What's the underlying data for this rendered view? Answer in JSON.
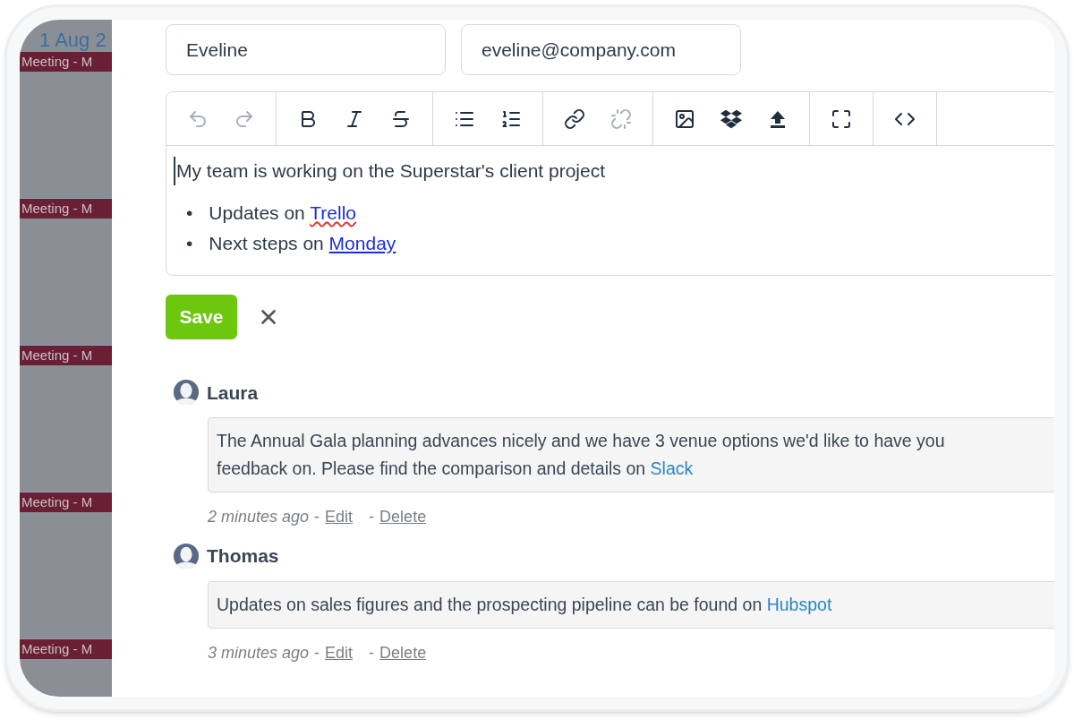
{
  "calendar": {
    "date": "1 Aug 2",
    "events": [
      {
        "label": "Meeting - M",
        "color": "#6b1f35"
      },
      {
        "label": "Meeting - M",
        "color": "#6b1f35"
      },
      {
        "label": "Meeting - M",
        "color": "#6b1f35"
      },
      {
        "label": "Meeting - M",
        "color": "#6b1f35"
      },
      {
        "label": "Meeting - M",
        "color": "#6b1f35"
      }
    ]
  },
  "form": {
    "name": {
      "value": "Eveline"
    },
    "email": {
      "value": "eveline@company.com"
    }
  },
  "toolbar": [
    {
      "group": [
        {
          "kind": "undo",
          "disabled": true
        },
        {
          "kind": "redo",
          "disabled": true
        }
      ]
    },
    {
      "group": [
        {
          "kind": "bold",
          "disabled": false
        },
        {
          "kind": "italic",
          "disabled": false
        },
        {
          "kind": "strikethrough",
          "disabled": false
        }
      ]
    },
    {
      "group": [
        {
          "kind": "bullet-list",
          "disabled": false
        },
        {
          "kind": "numbered-list",
          "disabled": false
        }
      ]
    },
    {
      "group": [
        {
          "kind": "link",
          "disabled": false
        },
        {
          "kind": "unlink",
          "disabled": true
        }
      ]
    },
    {
      "group": [
        {
          "kind": "image",
          "disabled": false
        },
        {
          "kind": "dropbox",
          "disabled": false
        },
        {
          "kind": "upload",
          "disabled": false
        }
      ]
    },
    {
      "group": [
        {
          "kind": "fullscreen",
          "disabled": false
        }
      ]
    },
    {
      "group": [
        {
          "kind": "code",
          "disabled": false
        }
      ]
    }
  ],
  "editor": {
    "paragraph": "My team is working on the Superstar's client project",
    "bullets": [
      {
        "marker": "•",
        "text": "Updates on",
        "link": "Trello",
        "misspelled": true
      },
      {
        "marker": "•",
        "text": "Next steps on",
        "link": "Monday",
        "misspelled": false
      }
    ]
  },
  "actions": {
    "save": "Save"
  },
  "comments": [
    {
      "author": "Laura",
      "lines": [
        "The Annual Gala planning advances nicely and we have 3 venue options we'd like to have you",
        "feedback on. Please find the comparison and details on"
      ],
      "link": "Slack",
      "time": "2 minutes ago",
      "separator": "-",
      "edit": "Edit",
      "delete_separator": "-",
      "delete": "Delete"
    },
    {
      "author": "Thomas",
      "lines": [
        "Updates on sales figures and the prospecting pipeline can be found on"
      ],
      "link": "Hubspot",
      "time": "3 minutes ago",
      "separator": "-",
      "edit": "Edit",
      "delete_separator": "-",
      "delete": "Delete"
    }
  ]
}
